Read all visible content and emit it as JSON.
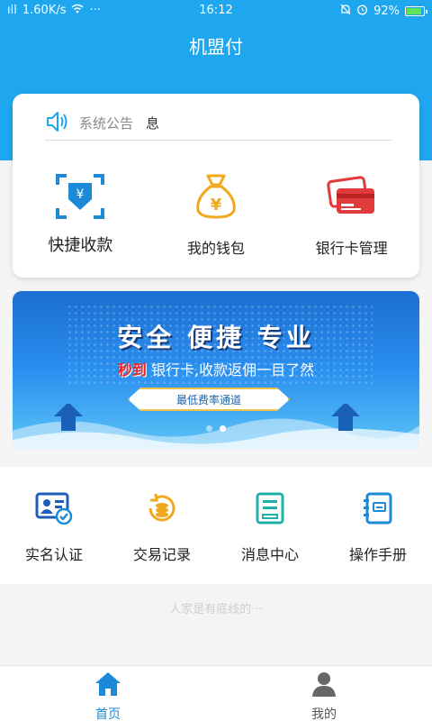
{
  "status_bar": {
    "signal": "ıll",
    "network_speed": "1.60K/s",
    "more": "···",
    "time": "16:12",
    "battery": "92%"
  },
  "app": {
    "title": "机盟付"
  },
  "notice": {
    "label": "系统公告",
    "text": "息"
  },
  "quick_actions": [
    {
      "label": "快捷收款",
      "icon": "qr-scan-yuan-icon"
    },
    {
      "label": "我的钱包",
      "icon": "money-bag-icon"
    },
    {
      "label": "银行卡管理",
      "icon": "bank-cards-icon"
    }
  ],
  "banner": {
    "title": "安全 便捷 专业",
    "sub_highlight": "秒到",
    "sub_text": "银行卡,收款返佣一目了然",
    "tag": "最低费率通道",
    "slides": 2,
    "active_slide": 2
  },
  "menu": [
    {
      "label": "实名认证",
      "icon": "id-card-verified-icon"
    },
    {
      "label": "交易记录",
      "icon": "coin-history-icon"
    },
    {
      "label": "消息中心",
      "icon": "message-document-icon"
    },
    {
      "label": "操作手册",
      "icon": "manual-book-icon"
    }
  ],
  "footer_hint": "人家是有底线的···",
  "tabs": [
    {
      "label": "首页",
      "icon": "home-icon",
      "active": true
    },
    {
      "label": "我的",
      "icon": "user-icon",
      "active": false
    }
  ],
  "colors": {
    "primary": "#1ea6ee",
    "accent_orange": "#f2a81d",
    "accent_red": "#e03a3a",
    "teal": "#20b2a8"
  }
}
